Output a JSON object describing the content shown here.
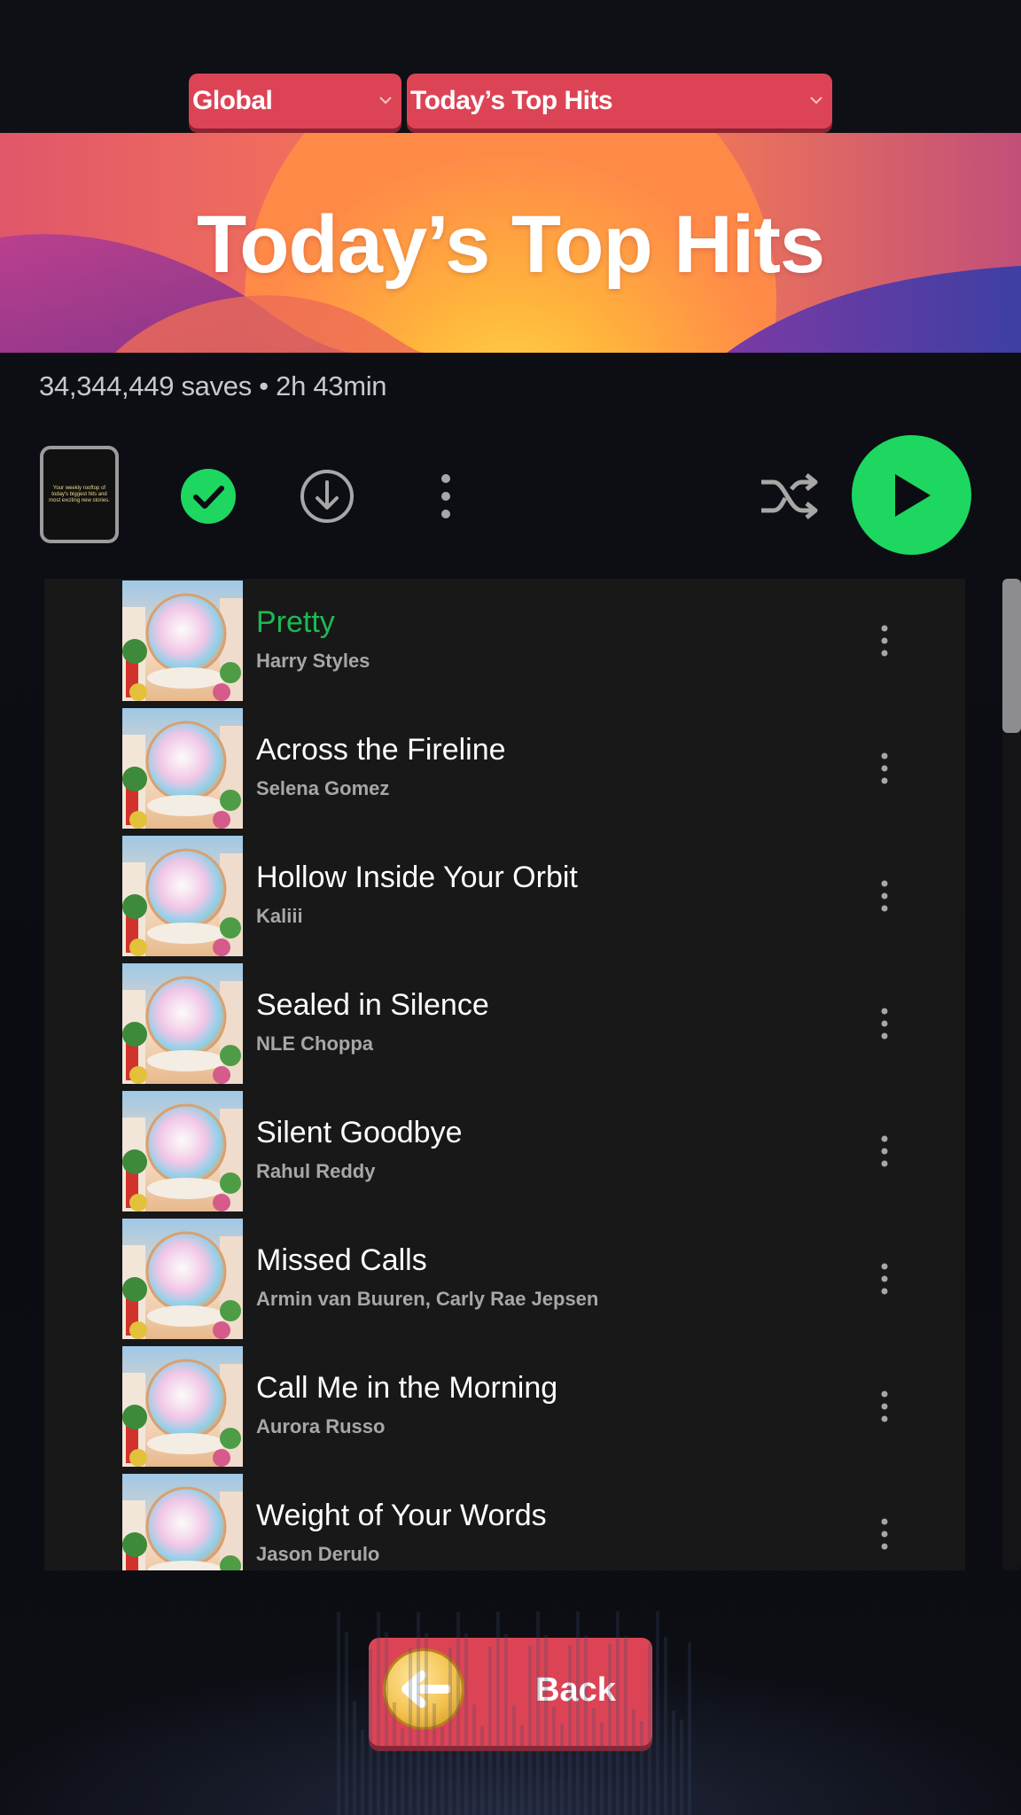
{
  "selectors": {
    "region": "Global",
    "playlist": "Today’s Top Hits"
  },
  "banner": {
    "title": "Today’s Top Hits"
  },
  "meta": "34,344,449 saves • 2h 43min",
  "cover_text": "Your weekly rooftop of today's biggest hits and most exciting new stories.",
  "controls": {
    "saved_icon": "check-circle-icon",
    "download_icon": "download-icon",
    "more_icon": "more-vertical-icon",
    "shuffle_icon": "shuffle-icon",
    "play_icon": "play-icon"
  },
  "tracks": [
    {
      "title": "Pretty",
      "artist": "Harry Styles",
      "active": true
    },
    {
      "title": "Across the Fireline",
      "artist": "Selena Gomez",
      "active": false
    },
    {
      "title": "Hollow Inside Your Orbit",
      "artist": "Kaliii",
      "active": false
    },
    {
      "title": "Sealed in Silence",
      "artist": "NLE Choppa",
      "active": false
    },
    {
      "title": "Silent Goodbye",
      "artist": "Rahul Reddy",
      "active": false
    },
    {
      "title": "Missed Calls",
      "artist": "Armin van Buuren, Carly Rae Jepsen",
      "active": false
    },
    {
      "title": "Call Me in the Morning",
      "artist": "Aurora Russo",
      "active": false
    },
    {
      "title": "Weight of Your Words",
      "artist": "Jason Derulo",
      "active": false
    }
  ],
  "back_button": {
    "label": "Back"
  },
  "colors": {
    "accent_red": "#dc4456",
    "spotify_green": "#1ed760",
    "active_track": "#1db954"
  }
}
